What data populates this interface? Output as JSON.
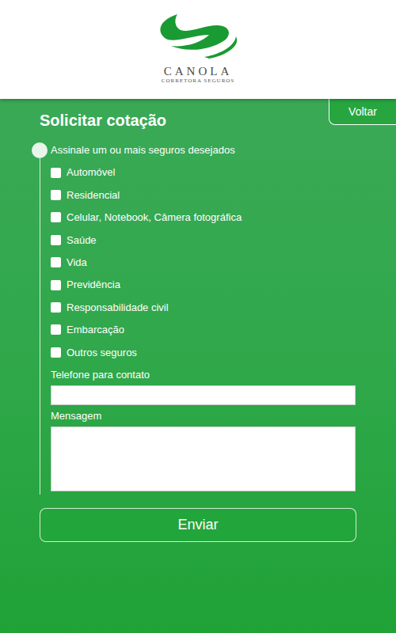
{
  "logo": {
    "name": "CANOLA",
    "tagline": "CORRETORA SEGUROS"
  },
  "form": {
    "title": "Solicitar cotação",
    "back_button": "Voltar",
    "instruction": "Assinale um ou mais seguros desejados",
    "options": [
      {
        "label": "Automóvel",
        "checked": false
      },
      {
        "label": "Residencial",
        "checked": false
      },
      {
        "label": "Celular, Notebook, Câmera fotográfica",
        "checked": false
      },
      {
        "label": "Saúde",
        "checked": false
      },
      {
        "label": "Vida",
        "checked": false
      },
      {
        "label": "Previdência",
        "checked": false
      },
      {
        "label": "Responsabilidade civil",
        "checked": false
      },
      {
        "label": "Embarcação",
        "checked": false
      },
      {
        "label": "Outros seguros",
        "checked": false
      }
    ],
    "fields": [
      {
        "label": "Telefone para contato",
        "kind": "input",
        "value": ""
      },
      {
        "label": "Mensagem",
        "kind": "textarea",
        "value": ""
      }
    ],
    "submit": "Enviar"
  }
}
